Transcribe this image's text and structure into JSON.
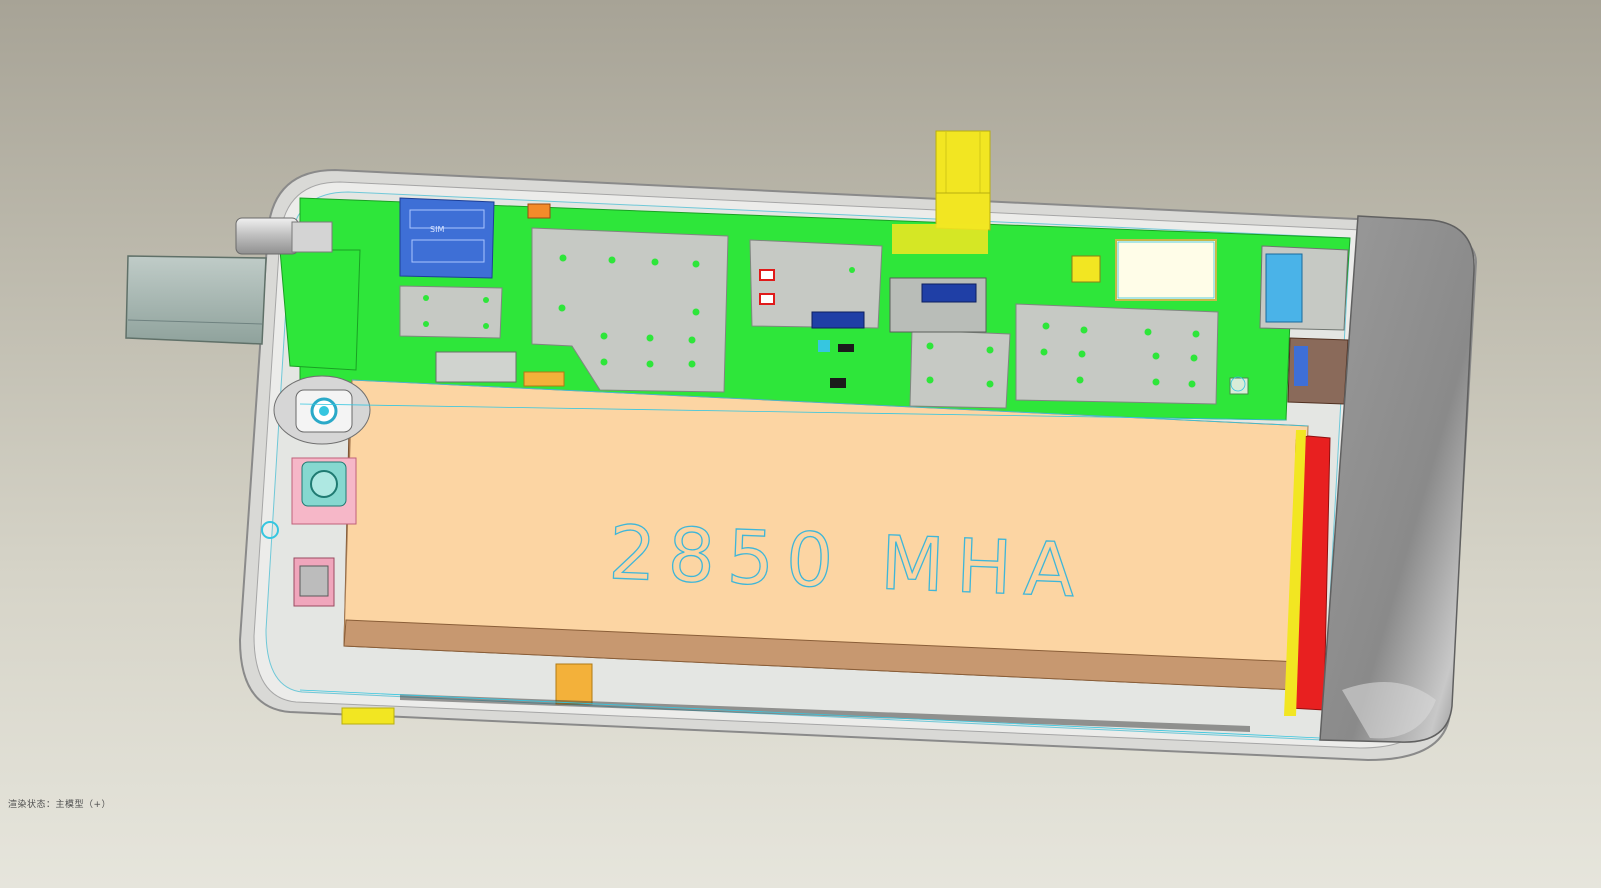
{
  "viewport": {
    "status_text": "渲染状态：主模型（+）"
  },
  "model": {
    "battery_label": "2850 MHA",
    "colors": {
      "background_top": "#a7a396",
      "background_bottom": "#e6e5dc",
      "pcb": "#2ee63a",
      "battery": "#fcd5a3",
      "battery_base": "#b8865e",
      "shield": "#c6c9c4",
      "sim_tray": "#3e6fd6",
      "flex_cable": "#f2e622",
      "red_strip": "#e82020",
      "usb_plug": "#a7b7b2",
      "end_cap": "#8f8f8f",
      "outline_cyan": "#36c6e0"
    },
    "icons": [
      "usb-plug-icon",
      "camera-lens-icon",
      "sim-slot-icon",
      "battery-icon",
      "flex-connector-icon"
    ]
  }
}
